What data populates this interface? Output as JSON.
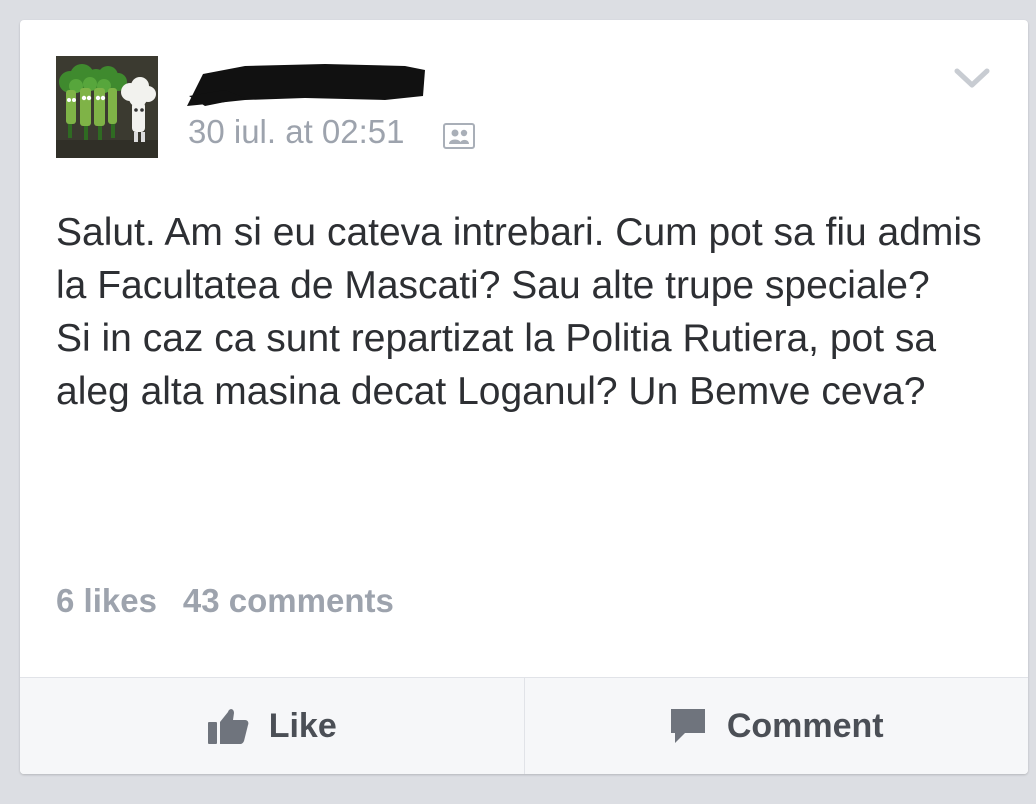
{
  "post": {
    "author_name": "",
    "timestamp": "30 iul. at 02:51",
    "privacy_icon": "group-audience-icon",
    "text": "Salut. Am si eu cateva intrebari. Cum pot sa fiu admis la Facultatea de Mascati? Sau alte trupe speciale?\nSi in caz ca sunt repartizat la Politia Rutiera, pot sa aleg alta masina decat Loganul? Un Bemve ceva?"
  },
  "stats": {
    "likes": "6 likes",
    "comments": "43 comments"
  },
  "actions": {
    "like_label": "Like",
    "comment_label": "Comment"
  },
  "colors": {
    "background": "#dcdee3",
    "card": "#ffffff",
    "text": "#2d2f33",
    "muted": "#9da3ad",
    "action_text": "#4b4f56"
  }
}
